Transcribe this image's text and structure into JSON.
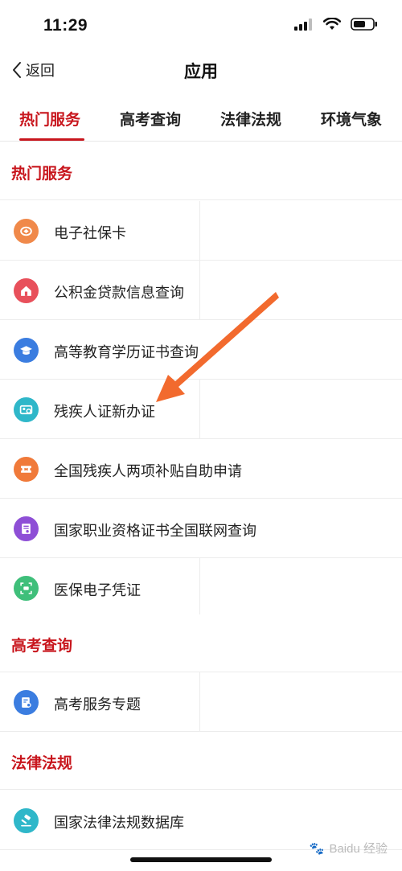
{
  "status_bar": {
    "time": "11:29"
  },
  "nav": {
    "back_label": "返回",
    "title": "应用"
  },
  "tabs": [
    {
      "label": "热门服务",
      "active": true
    },
    {
      "label": "高考查询",
      "active": false
    },
    {
      "label": "法律法规",
      "active": false
    },
    {
      "label": "环境气象",
      "active": false
    }
  ],
  "sections": {
    "hot": {
      "title": "热门服务",
      "items": [
        {
          "label": "电子社保卡",
          "icon": "social-security-card-icon",
          "color": "#f0894a"
        },
        {
          "label": "公积金贷款信息查询",
          "icon": "housing-fund-icon",
          "color": "#e8505b"
        },
        {
          "label": "高等教育学历证书查询",
          "icon": "graduation-cap-icon",
          "color": "#3b7de0"
        },
        {
          "label": "残疾人证新办证",
          "icon": "id-card-icon",
          "color": "#2fb7c9"
        },
        {
          "label": "全国残疾人两项补贴自助申请",
          "icon": "ticket-icon",
          "color": "#f07a3a"
        },
        {
          "label": "国家职业资格证书全国联网查询",
          "icon": "certificate-icon",
          "color": "#8e4fd6"
        },
        {
          "label": "医保电子凭证",
          "icon": "medical-insurance-icon",
          "color": "#3fbf7a"
        }
      ]
    },
    "gaokao": {
      "title": "高考查询",
      "items": [
        {
          "label": "高考服务专题",
          "icon": "exam-document-icon",
          "color": "#3b7de0"
        }
      ]
    },
    "law": {
      "title": "法律法规",
      "items": [
        {
          "label": "国家法律法规数据库",
          "icon": "gavel-icon",
          "color": "#2fb7c9"
        }
      ]
    }
  },
  "watermark": {
    "text": "Baidu 经验"
  },
  "colors": {
    "accent": "#c8161d",
    "arrow": "#f26a2e"
  }
}
